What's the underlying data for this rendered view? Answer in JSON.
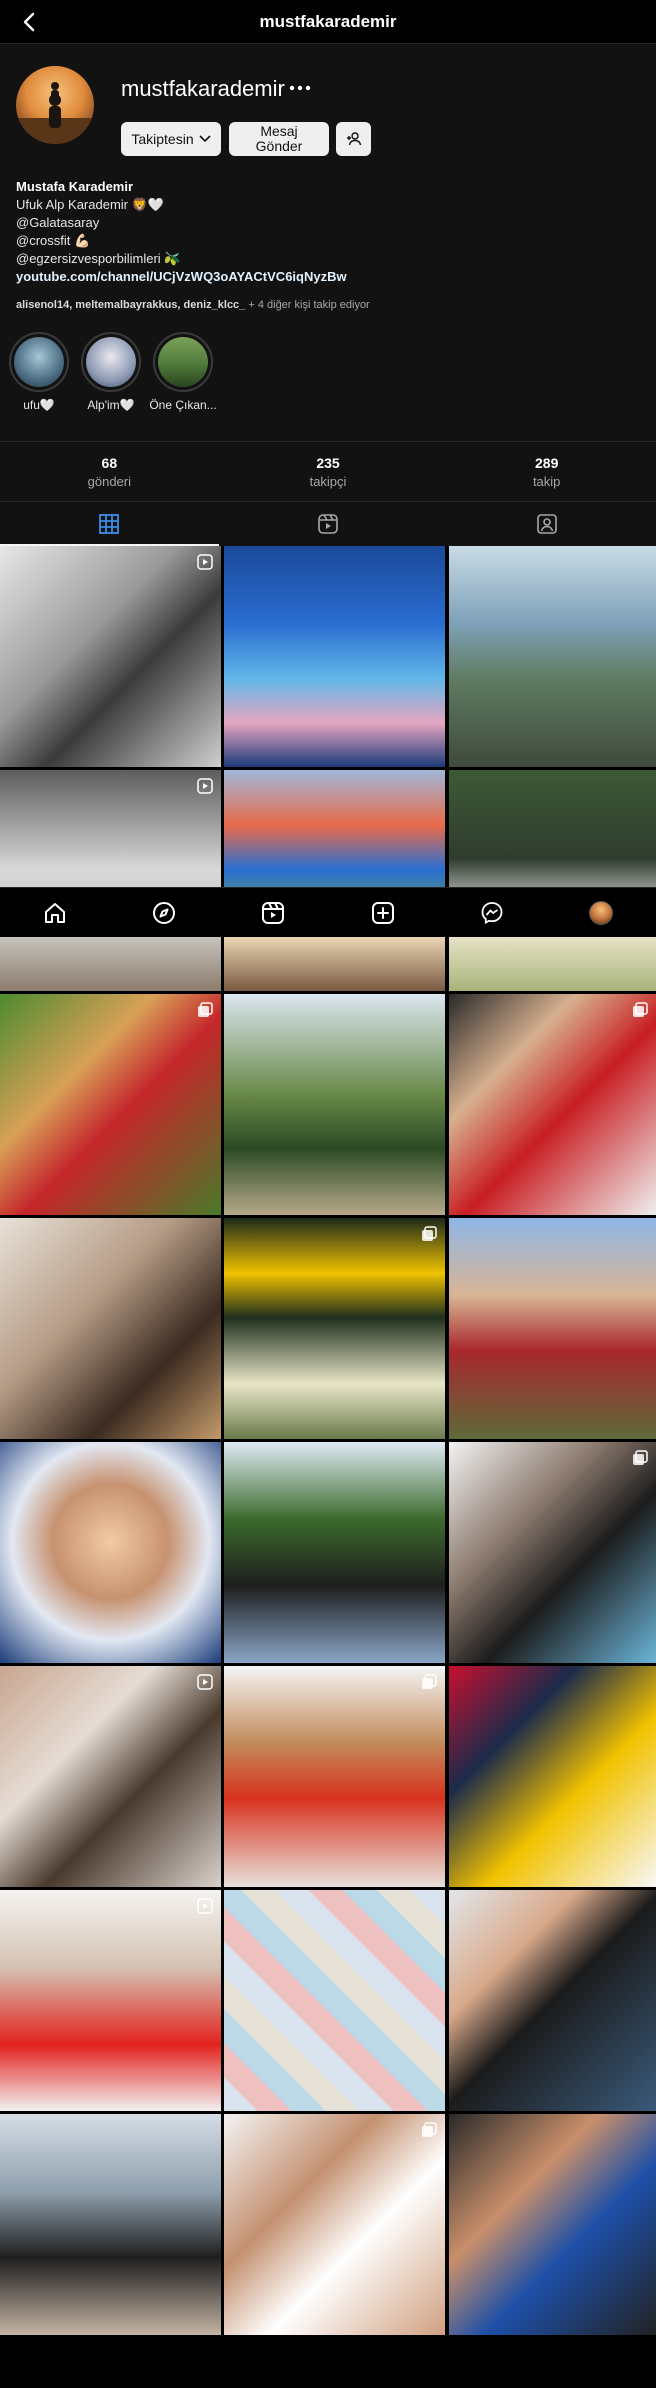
{
  "header": {
    "title": "mustfakarademir"
  },
  "profile": {
    "username": "mustfakarademir",
    "follow_button": "Takiptesin",
    "message_button": "Mesaj Gönder",
    "bio": {
      "name": "Mustafa Karademir",
      "line1": "Ufuk Alp Karademir 🦁🤍",
      "line2": "@Galatasaray",
      "line3": "@crossfit 💪🏻",
      "line4": "@egzersizvesporbilimleri 🫒",
      "link": "youtube.com/channel/UCjVzWQ3oAYACtVC6iqNyzBw"
    },
    "followed_by": {
      "names": "alisenol14, meltemalbayrakkus, deniz_klcc_",
      "rest": " + 4 diğer kişi takip ediyor"
    },
    "highlights": [
      {
        "label": "ufu🤍"
      },
      {
        "label": "Alp'im🤍"
      },
      {
        "label": "Öne Çıkan..."
      }
    ]
  },
  "stats": [
    {
      "value": "68",
      "label": "gönderi"
    },
    {
      "value": "235",
      "label": "takipçi"
    },
    {
      "value": "289",
      "label": "takip"
    }
  ],
  "tabs": [
    {
      "name": "grid",
      "icon": "grid-icon",
      "active": true
    },
    {
      "name": "reels",
      "icon": "reels-icon",
      "active": false
    },
    {
      "name": "tagged",
      "icon": "tagged-icon",
      "active": false
    }
  ],
  "bottom_nav": [
    {
      "icon": "home-icon"
    },
    {
      "icon": "explore-icon"
    },
    {
      "icon": "reels-icon"
    },
    {
      "icon": "new-post-icon"
    },
    {
      "icon": "messenger-icon"
    },
    {
      "icon": "profile-avatar"
    }
  ],
  "colors": {
    "background": "#000000",
    "panel": "#121212",
    "button_bg": "#efefef",
    "muted_text": "#a8a8a8",
    "link_text": "#e0f1ff"
  }
}
